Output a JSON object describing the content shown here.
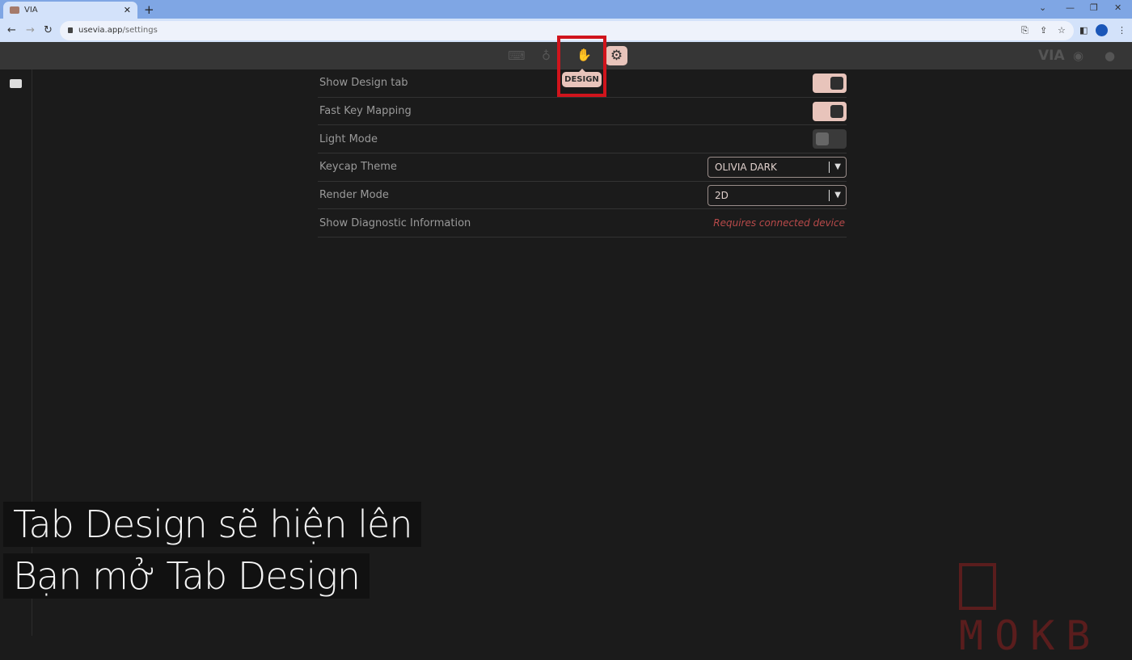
{
  "browser": {
    "tab_title": "VIA",
    "url_host": "usevia.app",
    "url_path": "/settings"
  },
  "header": {
    "active_tab_tooltip": "DESIGN",
    "brand": "VIA"
  },
  "settings": [
    {
      "label": "Show Design tab",
      "type": "toggle",
      "value": true
    },
    {
      "label": "Fast Key Mapping",
      "type": "toggle",
      "value": true
    },
    {
      "label": "Light Mode",
      "type": "toggle",
      "value": false
    },
    {
      "label": "Keycap Theme",
      "type": "select",
      "value": "OLIVIA DARK"
    },
    {
      "label": "Render Mode",
      "type": "select",
      "value": "2D"
    },
    {
      "label": "Show Diagnostic Information",
      "type": "note",
      "value": "Requires connected device"
    }
  ],
  "captions": [
    "Tab Design sẽ hiện lên",
    "Bạn mở Tab Design"
  ],
  "watermark": "MOKB",
  "colors": {
    "accent": "#e8c4bb",
    "highlight": "#d0141c",
    "warning": "#b84a4a"
  }
}
